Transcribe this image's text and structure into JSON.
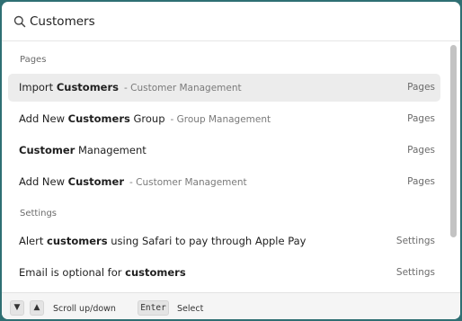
{
  "search": {
    "value": "Customers",
    "icon": "search-icon"
  },
  "sections": [
    {
      "label": "Pages",
      "items": [
        {
          "prefix": "Import ",
          "match": "Customers",
          "suffix": "",
          "subtitle": "- Customer Management",
          "category": "Pages",
          "selected": true
        },
        {
          "prefix": "Add New ",
          "match": "Customers",
          "suffix": " Group",
          "subtitle": "- Group Management",
          "category": "Pages",
          "selected": false
        },
        {
          "prefix": "",
          "match": "Customer",
          "suffix": " Management",
          "subtitle": "",
          "category": "Pages",
          "selected": false
        },
        {
          "prefix": "Add New ",
          "match": "Customer",
          "suffix": "",
          "subtitle": "- Customer Management",
          "category": "Pages",
          "selected": false
        }
      ]
    },
    {
      "label": "Settings",
      "items": [
        {
          "prefix": "Alert ",
          "match": "customers",
          "suffix": " using Safari to pay through Apple Pay",
          "subtitle": "",
          "category": "Settings",
          "selected": false
        },
        {
          "prefix": "Email is optional for ",
          "match": "customers",
          "suffix": "",
          "subtitle": "",
          "category": "Settings",
          "selected": false
        }
      ]
    }
  ],
  "footer": {
    "down_key": "▼",
    "up_key": "▲",
    "scroll_label": "Scroll up/down",
    "enter_key": "Enter",
    "select_label": "Select"
  },
  "colors": {
    "backdrop": "#2f6f73",
    "selected_row": "#ececec"
  }
}
